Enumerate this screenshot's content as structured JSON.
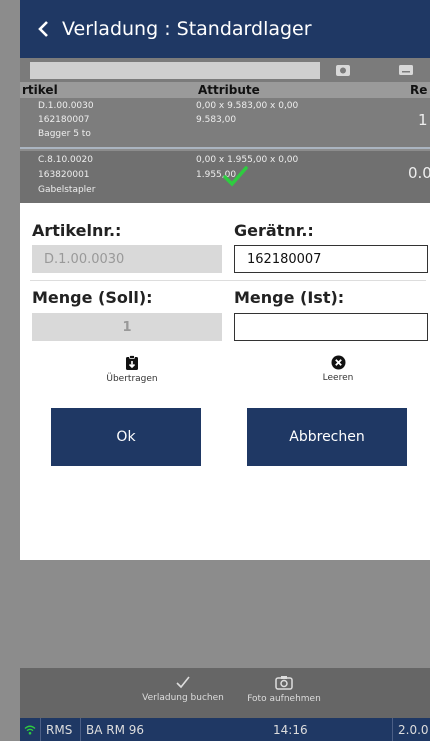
{
  "header": {
    "back_icon": "chevron-left-icon",
    "title": "Verladung : Standardlager"
  },
  "search": {
    "value": "",
    "placeholder": ""
  },
  "table": {
    "columns": [
      "rtikel",
      "Attribute",
      "Re"
    ],
    "rows": [
      {
        "artikel": [
          "D.1.00.0030",
          "162180007",
          "Bagger 5 to"
        ],
        "attribute": [
          "0,00 x 9.583,00 x 0,00",
          "9.583,00"
        ],
        "rest": "1"
      },
      {
        "artikel": [
          "C.8.10.0020",
          "163820001",
          "Gabelstapler"
        ],
        "attribute": [
          "0,00 x 1.955,00 x 0,00",
          "1.955,00"
        ],
        "rest": "0.0"
      }
    ]
  },
  "dialog": {
    "artikelnr_label": "Artikelnr.:",
    "artikelnr_value": "D.1.00.0030",
    "geraetnr_label": "Gerätnr.:",
    "geraetnr_value": "162180007",
    "menge_soll_label": "Menge (Soll):",
    "menge_soll_value": "1",
    "menge_ist_label": "Menge (Ist):",
    "menge_ist_value": "",
    "uebertragen_label": "Übertragen",
    "leeren_label": "Leeren",
    "ok_label": "Ok",
    "abbrechen_label": "Abbrechen"
  },
  "footer": {
    "verladung_buchen_label": "Verladung buchen",
    "foto_aufnehmen_label": "Foto aufnehmen"
  },
  "statusbar": {
    "rms": "RMS",
    "location": "BA RM 96",
    "time": "14:16",
    "version": "2.0.0"
  },
  "colors": {
    "primary": "#1f3864",
    "check": "#2ecc40"
  }
}
